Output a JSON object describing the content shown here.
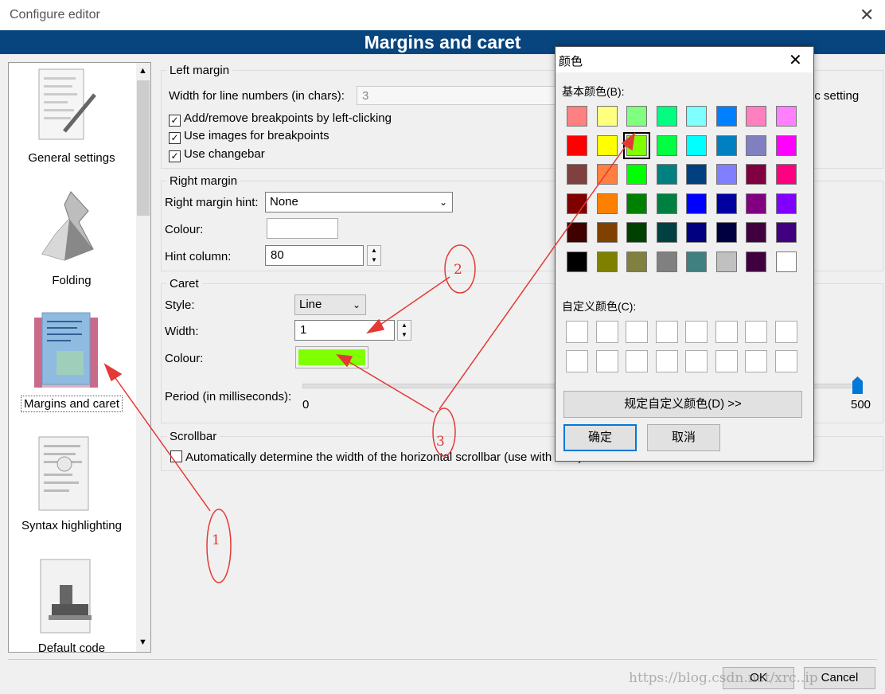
{
  "window": {
    "title": "Configure editor",
    "close_glyph": "✕"
  },
  "header": {
    "title": "Margins and caret"
  },
  "sidebar": {
    "items": [
      {
        "label": "General settings"
      },
      {
        "label": "Folding"
      },
      {
        "label": "Margins and caret"
      },
      {
        "label": "Syntax highlighting"
      },
      {
        "label": "Default code"
      }
    ]
  },
  "left_margin": {
    "legend": "Left margin",
    "line_numbers_label": "Width for line numbers (in chars):",
    "line_numbers_value": "3",
    "dynamic_setting_partial": "ic setting",
    "cb1": "Add/remove breakpoints by left-clicking",
    "cb2": "Use images for breakpoints",
    "cb3": "Use changebar"
  },
  "right_margin": {
    "legend": "Right margin",
    "hint_label": "Right margin hint:",
    "hint_value": "None",
    "colour_label": "Colour:",
    "hint_col_label": "Hint column:",
    "hint_col_value": "80"
  },
  "caret": {
    "legend": "Caret",
    "style_label": "Style:",
    "style_value": "Line",
    "width_label": "Width:",
    "width_value": "1",
    "colour_label": "Colour:",
    "colour": "#80ff00",
    "period_label": "Period (in milliseconds):",
    "slider_min": "0",
    "slider_max": "500"
  },
  "scrollbar_group": {
    "legend": "Scrollbar",
    "cb": "Automatically determine the width of the horizontal scrollbar (use with care)"
  },
  "footer": {
    "ok": "OK",
    "cancel": "Cancel",
    "watermark": "https://blog.csdn.net/xrc..ip"
  },
  "color_dialog": {
    "title": "颜色",
    "basic_label": "基本颜色(B):",
    "custom_label": "自定义颜色(C):",
    "define_button": "规定自定义颜色(D) >>",
    "ok_button": "确定",
    "cancel_button": "取消",
    "selected_index": 10,
    "basic_colors": [
      "#ff8080",
      "#ffff80",
      "#80ff80",
      "#00ff80",
      "#80ffff",
      "#0080ff",
      "#ff80c0",
      "#ff80ff",
      "#ff0000",
      "#ffff00",
      "#80ff00",
      "#00ff40",
      "#00ffff",
      "#0080c0",
      "#8080c0",
      "#ff00ff",
      "#804040",
      "#ff8040",
      "#00ff00",
      "#008080",
      "#004080",
      "#8080ff",
      "#800040",
      "#ff0080",
      "#800000",
      "#ff8000",
      "#008000",
      "#008040",
      "#0000ff",
      "#0000a0",
      "#800080",
      "#8000ff",
      "#400000",
      "#804000",
      "#004000",
      "#004040",
      "#000080",
      "#000040",
      "#400040",
      "#400080",
      "#000000",
      "#808000",
      "#808040",
      "#808080",
      "#408080",
      "#c0c0c0",
      "#400040",
      "#ffffff"
    ]
  },
  "annotations": {
    "n1": "1",
    "n2": "2",
    "n3": "3",
    "color": "#e53935"
  }
}
